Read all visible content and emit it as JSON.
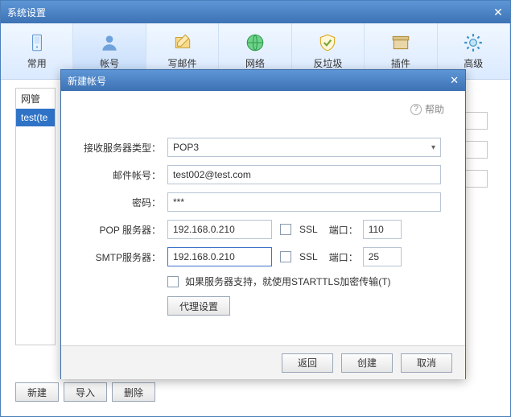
{
  "window": {
    "title": "系统设置"
  },
  "tabs": [
    {
      "label": "常用"
    },
    {
      "label": "帐号"
    },
    {
      "label": "写邮件"
    },
    {
      "label": "网络"
    },
    {
      "label": "反垃圾"
    },
    {
      "label": "插件"
    },
    {
      "label": "高级"
    }
  ],
  "sidebar": {
    "item0": "网管",
    "item1": "test(te"
  },
  "bottom": {
    "new": "新建",
    "import": "导入",
    "delete": "删除"
  },
  "dialog": {
    "title": "新建帐号",
    "help": "帮助",
    "labels": {
      "recvType": "接收服务器类型：",
      "mailAcct": "邮件帐号：",
      "password": "密码：",
      "pop": "POP 服务器：",
      "smtp": "SMTP服务器：",
      "ssl": "SSL",
      "port": "端口："
    },
    "values": {
      "recvType": "POP3",
      "mailAcct": "test002@test.com",
      "password": "***",
      "popServer": "192.168.0.210",
      "popPort": "110",
      "smtpServer": "192.168.0.210",
      "smtpPort": "25"
    },
    "starttls": "如果服务器支持，就使用STARTTLS加密传输(T)",
    "proxy": "代理设置",
    "buttons": {
      "back": "返回",
      "create": "创建",
      "cancel": "取消"
    }
  }
}
